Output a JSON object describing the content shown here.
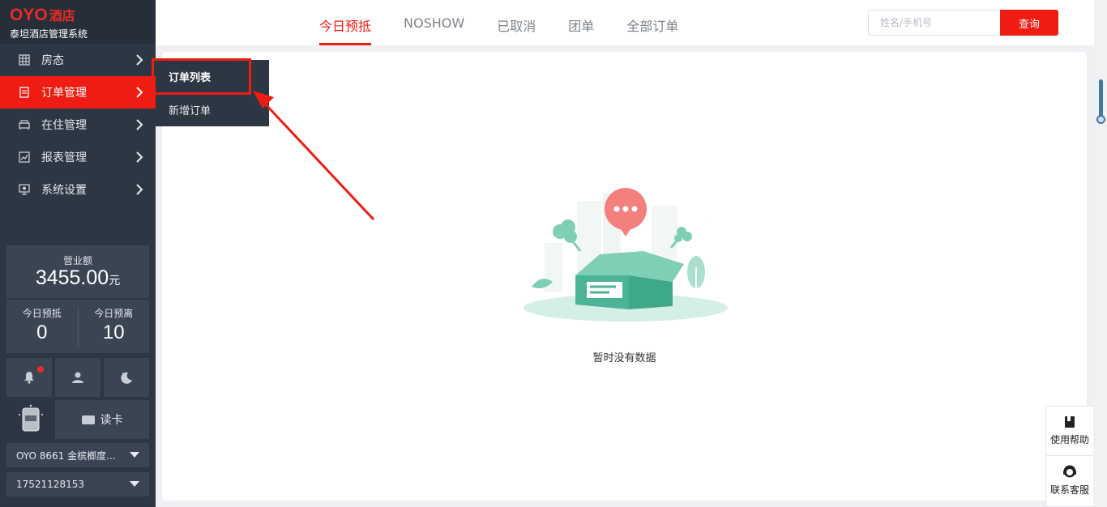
{
  "brand": {
    "logo": "OYO",
    "hotel": "酒店",
    "subtitle": "泰坦酒店管理系统"
  },
  "sidebar": {
    "items": [
      {
        "label": "房态",
        "icon": "grid-icon"
      },
      {
        "label": "订单管理",
        "icon": "order-icon",
        "active": true
      },
      {
        "label": "在住管理",
        "icon": "bed-icon"
      },
      {
        "label": "报表管理",
        "icon": "chart-icon"
      },
      {
        "label": "系统设置",
        "icon": "settings-icon"
      }
    ]
  },
  "submenu": {
    "items": [
      {
        "label": "订单列表"
      },
      {
        "label": "新增订单"
      }
    ]
  },
  "stats": {
    "revenue_label": "营业额",
    "revenue_value": "3455.00",
    "revenue_unit": "元",
    "arrive_label": "今日预抵",
    "arrive_value": "0",
    "depart_label": "今日预离",
    "depart_value": "10"
  },
  "tools": {
    "read_card": "读卡"
  },
  "selects": {
    "hotel": "OYO 8661 金槟榔度...",
    "phone": "17521128153"
  },
  "tabs": [
    {
      "label": "今日预抵",
      "active": true
    },
    {
      "label": "NOSHOW"
    },
    {
      "label": "已取消"
    },
    {
      "label": "团单"
    },
    {
      "label": "全部订单"
    }
  ],
  "search": {
    "placeholder": "姓名/手机号",
    "button": "查询"
  },
  "main": {
    "empty_text": "暂时没有数据"
  },
  "float": {
    "help": "使用帮助",
    "service": "联系客服"
  },
  "colors": {
    "accent": "#ee1c12",
    "sidebar": "#2d3643",
    "illustration": "#5bbfa3"
  }
}
